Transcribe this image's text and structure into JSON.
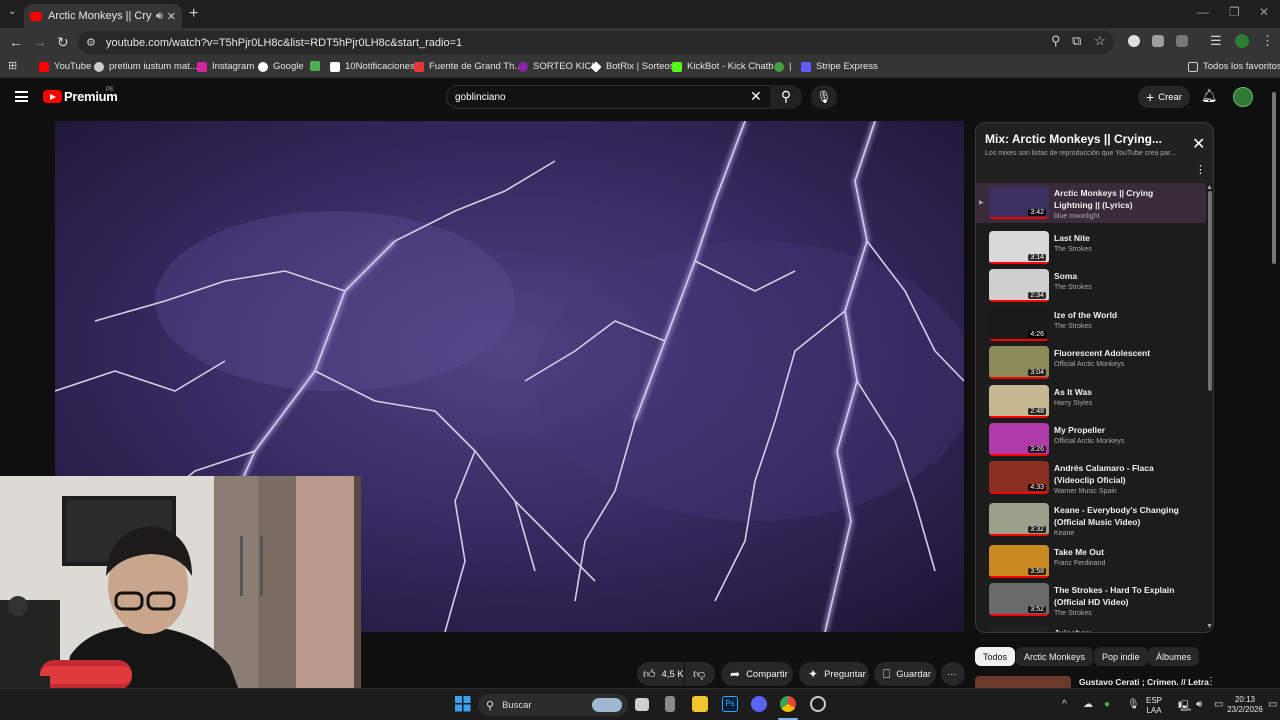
{
  "browser": {
    "tab_title": "Arctic Monkeys || Crying Lig",
    "url": "youtube.com/watch?v=T5hPjr0LH8c&list=RDT5hPjr0LH8c&start_radio=1",
    "bookmarks": [
      {
        "label": "YouTube",
        "color": "#ff0000"
      },
      {
        "label": "pretium iustum mat...",
        "color": "#cccccc"
      },
      {
        "label": "Instagram",
        "color": "#d6249f"
      },
      {
        "label": "Google",
        "color": "#ffffff"
      },
      {
        "label": "",
        "color": "#4caf50"
      },
      {
        "label": "10Notificaciones",
        "color": "#ffffff"
      },
      {
        "label": "Fuente de Grand Th...",
        "color": "#e53935"
      },
      {
        "label": "SORTEO KICK",
        "color": "#8e24aa"
      },
      {
        "label": "BotRix | Sorteos",
        "color": "#ffffff"
      },
      {
        "label": "KickBot - Kick Chatb...",
        "color": "#53fc18"
      },
      {
        "label": "|",
        "color": "#43a047"
      },
      {
        "label": "Stripe Express",
        "color": "#635bff"
      }
    ],
    "all_bookmarks": "Todos los favoritos"
  },
  "youtube": {
    "brand": "Premium",
    "country": "PE",
    "search_value": "goblinciano",
    "create_label": "Crear"
  },
  "actions": {
    "likes": "4,5 K",
    "share": "Compartir",
    "ask": "Preguntar",
    "save": "Guardar"
  },
  "playlist": {
    "title": "Mix: Arctic Monkeys || Crying...",
    "subtitle": "Los mixes son listas de reproducción que YouTube crea par...",
    "items": [
      {
        "title": "Arctic Monkeys || Crying Lightning || (Lyrics)",
        "channel": "blue moonlight",
        "duration": "3:42",
        "color": "#3b3060"
      },
      {
        "title": "Last Nite",
        "channel": "The Strokes",
        "duration": "3:14",
        "color": "#d9d9d9"
      },
      {
        "title": "Soma",
        "channel": "The Strokes",
        "duration": "2:34",
        "color": "#cfcfcf"
      },
      {
        "title": "Ize of the World",
        "channel": "The Strokes",
        "duration": "4:26",
        "color": "#1a1a1a"
      },
      {
        "title": "Fluorescent Adolescent",
        "channel": "Official Arctic Monkeys",
        "duration": "3:04",
        "color": "#8a8a5a"
      },
      {
        "title": "As It Was",
        "channel": "Harry Styles",
        "duration": "2:48",
        "color": "#c8b890"
      },
      {
        "title": "My Propeller",
        "channel": "Official Arctic Monkeys",
        "duration": "3:26",
        "color": "#b03aa8"
      },
      {
        "title": "Andrés Calamaro - Flaca (Videoclip Oficial)",
        "channel": "Warner Music Spain",
        "duration": "4:33",
        "color": "#8a3020"
      },
      {
        "title": "Keane - Everybody's Changing (Official Music Video)",
        "channel": "Keane",
        "duration": "3:32",
        "color": "#9aa08a"
      },
      {
        "title": "Take Me Out",
        "channel": "Franz Ferdinand",
        "duration": "3:58",
        "color": "#c88a20"
      },
      {
        "title": "The Strokes - Hard To Explain (Official HD Video)",
        "channel": "The Strokes",
        "duration": "3:52",
        "color": "#6a6a6a"
      },
      {
        "title": "Juicebox",
        "channel": "",
        "duration": "",
        "color": "#222222"
      }
    ]
  },
  "chips": [
    "Todos",
    "Arctic Monkeys",
    "Pop indie",
    "Álbumes"
  ],
  "next_video": "Gustavo Cerati ; Crimen. // Letra",
  "taskbar": {
    "search": "Buscar",
    "lang_top": "ESP",
    "lang_bottom": "LAA",
    "time": "20:13",
    "date": "23/2/2026"
  }
}
